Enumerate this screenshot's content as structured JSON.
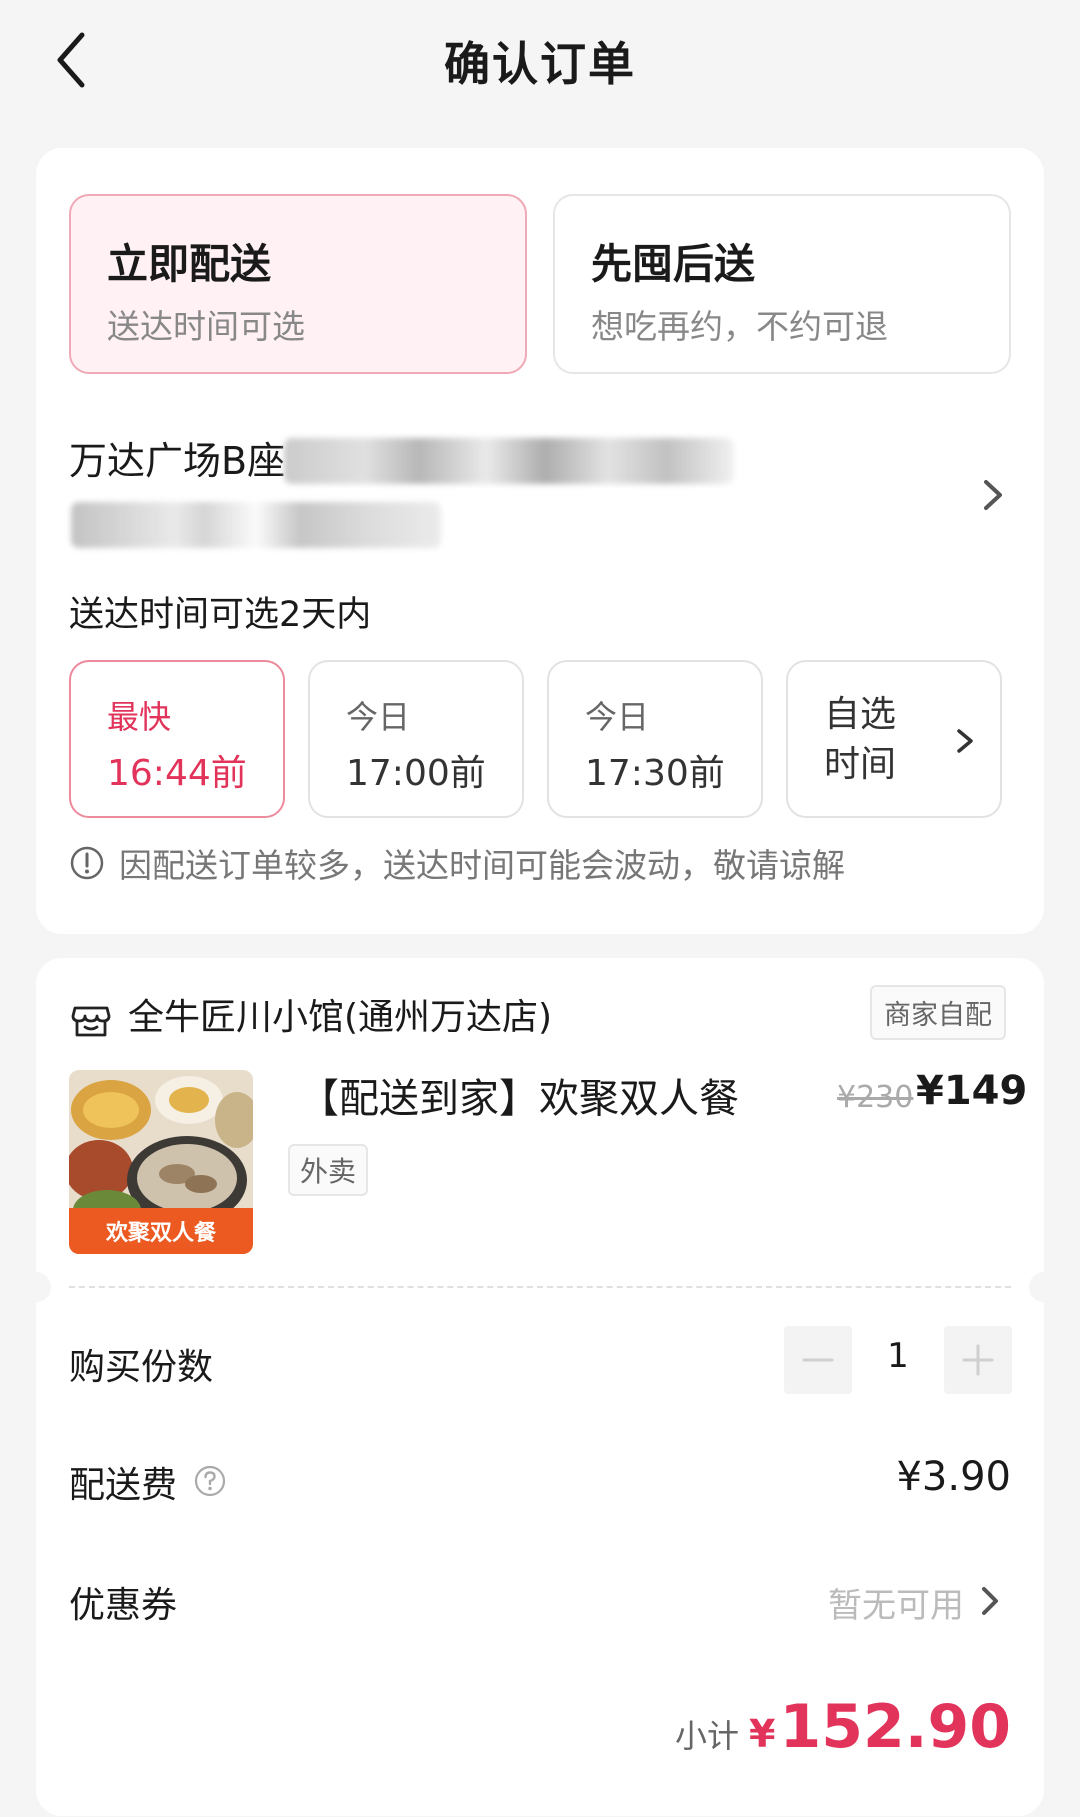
{
  "header": {
    "title": "确认订单"
  },
  "delivery_modes": [
    {
      "title": "立即配送",
      "subtitle": "送达时间可选"
    },
    {
      "title": "先囤后送",
      "subtitle": "想吃再约，不约可退"
    }
  ],
  "address": {
    "line1": "万达广场B座"
  },
  "delivery_time": {
    "title": "送达时间可选2天内",
    "slots": [
      {
        "label": "最快",
        "time": "16:44前"
      },
      {
        "label": "今日",
        "time": "17:00前"
      },
      {
        "label": "今日",
        "time": "17:30前"
      }
    ],
    "custom_label": "自选时间",
    "notice": "因配送订单较多，送达时间可能会波动，敬请谅解"
  },
  "store": {
    "name": "全牛匠川小馆(通州万达店)",
    "badge": "商家自配"
  },
  "product": {
    "title": "【配送到家】欢聚双人餐",
    "tag": "外卖",
    "original_price": "¥230",
    "price": "¥149",
    "image_caption": "欢聚双人餐"
  },
  "order": {
    "quantity_label": "购买份数",
    "quantity": "1",
    "fee_label": "配送费",
    "fee_value": "¥3.90",
    "coupon_label": "优惠券",
    "coupon_value": "暂无可用",
    "subtotal_label": "小计",
    "subtotal_currency": "¥",
    "subtotal_value": "152.90"
  },
  "colors": {
    "accent": "#e2335a",
    "active_bg": "#fff1f4",
    "active_border": "#f0a9b6"
  },
  "icons": [
    "back-arrow-icon",
    "chevron-right-icon",
    "info-icon",
    "store-icon",
    "minus-icon",
    "plus-icon",
    "help-icon"
  ]
}
